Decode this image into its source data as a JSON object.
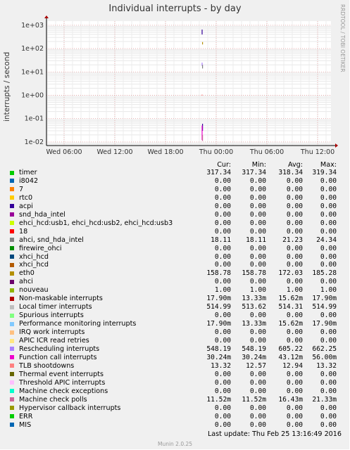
{
  "chart_data": {
    "type": "line",
    "title": "Individual interrupts - by day",
    "ylabel": "interrupts / second",
    "side_label": "RRDTOOL / TOBI OETIKER",
    "yscale": "log",
    "ylim": [
      0.007,
      1500
    ],
    "y_ticks": [
      "1e+03",
      "1e+02",
      "1e+01",
      "1e+00",
      "1e-01",
      "1e-02"
    ],
    "x_ticks": [
      "Wed 06:00",
      "Wed 12:00",
      "Wed 18:00",
      "Thu 00:00",
      "Thu 06:00",
      "Thu 12:00"
    ],
    "columns": [
      "Cur:",
      "Min:",
      "Avg:",
      "Max:"
    ],
    "series": [
      {
        "name": "timer",
        "color": "#00cc00",
        "values": [
          "317.34",
          "317.34",
          "318.34",
          "319.34"
        ]
      },
      {
        "name": "i8042",
        "color": "#0066b3",
        "values": [
          "0.00",
          "0.00",
          "0.00",
          "0.00"
        ]
      },
      {
        "name": "7",
        "color": "#ff8000",
        "values": [
          "0.00",
          "0.00",
          "0.00",
          "0.00"
        ]
      },
      {
        "name": "rtc0",
        "color": "#ffcc00",
        "values": [
          "0.00",
          "0.00",
          "0.00",
          "0.00"
        ]
      },
      {
        "name": "acpi",
        "color": "#330099",
        "values": [
          "0.00",
          "0.00",
          "0.00",
          "0.00"
        ]
      },
      {
        "name": "snd_hda_intel",
        "color": "#990099",
        "values": [
          "0.00",
          "0.00",
          "0.00",
          "0.00"
        ]
      },
      {
        "name": "ehci_hcd:usb1,  ehci_hcd:usb2,  ehci_hcd:usb3",
        "color": "#ccff00",
        "values": [
          "0.00",
          "0.00",
          "0.00",
          "0.00"
        ]
      },
      {
        "name": "18",
        "color": "#ff0000",
        "values": [
          "0.00",
          "0.00",
          "0.00",
          "0.00"
        ]
      },
      {
        "name": "ahci, snd_hda_intel",
        "color": "#808080",
        "values": [
          "18.11",
          "18.11",
          "21.23",
          "24.34"
        ]
      },
      {
        "name": "firewire_ohci",
        "color": "#008f00",
        "values": [
          "0.00",
          "0.00",
          "0.00",
          "0.00"
        ]
      },
      {
        "name": "xhci_hcd",
        "color": "#00487d",
        "values": [
          "0.00",
          "0.00",
          "0.00",
          "0.00"
        ]
      },
      {
        "name": "xhci_hcd",
        "color": "#b35a00",
        "values": [
          "0.00",
          "0.00",
          "0.00",
          "0.00"
        ]
      },
      {
        "name": "eth0",
        "color": "#b38f00",
        "values": [
          "158.78",
          "158.78",
          "172.03",
          "185.28"
        ]
      },
      {
        "name": "ahci",
        "color": "#6b006b",
        "values": [
          "0.00",
          "0.00",
          "0.00",
          "0.00"
        ]
      },
      {
        "name": "nouveau",
        "color": "#8fb300",
        "values": [
          "1.00",
          "1.00",
          "1.00",
          "1.00"
        ]
      },
      {
        "name": "Non-maskable interrupts",
        "color": "#b30000",
        "values": [
          "17.90m",
          "13.33m",
          "15.62m",
          "17.90m"
        ]
      },
      {
        "name": "Local timer interrupts",
        "color": "#bebebe",
        "values": [
          "514.99",
          "513.62",
          "514.31",
          "514.99"
        ]
      },
      {
        "name": "Spurious interrupts",
        "color": "#80ff80",
        "values": [
          "0.00",
          "0.00",
          "0.00",
          "0.00"
        ]
      },
      {
        "name": "Performance monitoring interrupts",
        "color": "#80c9ff",
        "values": [
          "17.90m",
          "13.33m",
          "15.62m",
          "17.90m"
        ]
      },
      {
        "name": "IRQ work interrupts",
        "color": "#ffc080",
        "values": [
          "0.00",
          "0.00",
          "0.00",
          "0.00"
        ]
      },
      {
        "name": "APIC ICR read retries",
        "color": "#ffe680",
        "values": [
          "0.00",
          "0.00",
          "0.00",
          "0.00"
        ]
      },
      {
        "name": "Rescheduling interrupts",
        "color": "#aa80ff",
        "values": [
          "548.19",
          "548.19",
          "605.22",
          "662.25"
        ]
      },
      {
        "name": "Function call interrupts",
        "color": "#ee00cc",
        "values": [
          "30.24m",
          "30.24m",
          "43.12m",
          "56.00m"
        ]
      },
      {
        "name": "TLB shootdowns",
        "color": "#ff8080",
        "values": [
          "13.32",
          "12.57",
          "12.94",
          "13.32"
        ]
      },
      {
        "name": "Thermal event interrupts",
        "color": "#666600",
        "values": [
          "0.00",
          "0.00",
          "0.00",
          "0.00"
        ]
      },
      {
        "name": "Threshold APIC interrupts",
        "color": "#ffbfff",
        "values": [
          "0.00",
          "0.00",
          "0.00",
          "0.00"
        ]
      },
      {
        "name": "Machine check exceptions",
        "color": "#00ffcc",
        "values": [
          "0.00",
          "0.00",
          "0.00",
          "0.00"
        ]
      },
      {
        "name": "Machine check polls",
        "color": "#cc6699",
        "values": [
          "11.52m",
          "11.52m",
          "16.43m",
          "21.33m"
        ]
      },
      {
        "name": "Hypervisor callback interrupts",
        "color": "#999900",
        "values": [
          "0.00",
          "0.00",
          "0.00",
          "0.00"
        ]
      },
      {
        "name": "ERR",
        "color": "#00cc00",
        "values": [
          "0.00",
          "0.00",
          "0.00",
          "0.00"
        ]
      },
      {
        "name": "MIS",
        "color": "#0066b3",
        "values": [
          "0.00",
          "0.00",
          "0.00",
          "0.00"
        ]
      }
    ],
    "spikes": [
      {
        "color": "#330099",
        "y": [
          400,
          650
        ]
      },
      {
        "color": "#b38f00",
        "y": [
          150,
          190
        ]
      },
      {
        "color": "#aa80ff",
        "y": [
          18,
          25
        ]
      },
      {
        "color": "#808080",
        "y": [
          14,
          20
        ]
      },
      {
        "color": "#ff0000",
        "y": [
          1,
          1.05
        ]
      },
      {
        "color": "#330099",
        "y": [
          0.03,
          0.06
        ]
      },
      {
        "color": "#ee00cc",
        "y": [
          0.012,
          0.05
        ]
      },
      {
        "color": "#cc6699",
        "y": [
          0.011,
          0.02
        ]
      }
    ]
  },
  "footer": {
    "last_update": "Last update:  Thu Feb 25 13:16:49 2016",
    "munin": "Munin 2.0.25"
  }
}
